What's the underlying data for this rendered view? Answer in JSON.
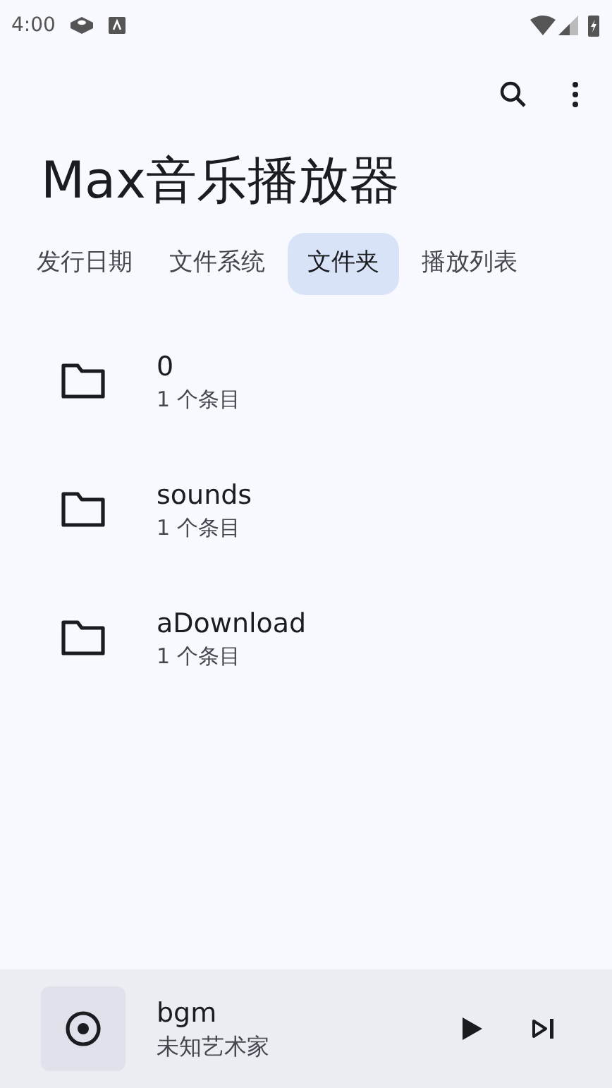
{
  "status_bar": {
    "time": "4:00"
  },
  "app_bar": {
    "title": "Max音乐播放器"
  },
  "tabs": [
    {
      "label": "发行日期",
      "selected": false
    },
    {
      "label": "文件系统",
      "selected": false
    },
    {
      "label": "文件夹",
      "selected": true
    },
    {
      "label": "播放列表",
      "selected": false
    }
  ],
  "folders": [
    {
      "name": "0",
      "count": "1 个条目"
    },
    {
      "name": "sounds",
      "count": "1 个条目"
    },
    {
      "name": "aDownload",
      "count": "1 个条目"
    }
  ],
  "now_playing": {
    "title": "bgm",
    "artist": "未知艺术家"
  }
}
